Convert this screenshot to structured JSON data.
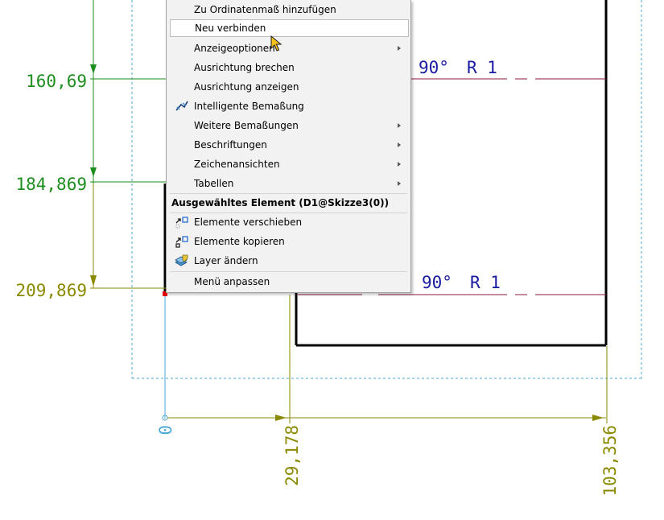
{
  "drawing": {
    "dims_left": [
      {
        "value": "160,69",
        "color": "#1e8f1e"
      },
      {
        "value": "184,869",
        "color": "#1e8f1e"
      },
      {
        "value": "209,869",
        "color": "#8a8a00"
      }
    ],
    "dims_bottom": [
      {
        "value": "0",
        "color": "#4aa7d4"
      },
      {
        "value": "29,178",
        "color": "#8a8a00"
      },
      {
        "value": "103,356",
        "color": "#8a8a00"
      }
    ],
    "annotations": [
      {
        "angle": "90°",
        "radius": "R 1"
      },
      {
        "angle": "90°",
        "radius": "R 1"
      }
    ],
    "colors": {
      "green_dim": "#1e8f1e",
      "olive_dim": "#8a8a00",
      "blue_origin": "#4aa7d4",
      "annotation_text": "#1a1aa0",
      "centerline": "#8b1a3a",
      "sheet_border": "#4aa7d4"
    }
  },
  "menu": {
    "items": [
      {
        "label": "Zu Ordinatenmaß hinzufügen",
        "icon": "",
        "submenu": false
      },
      {
        "label": "Neu verbinden",
        "icon": "",
        "submenu": false,
        "hover": true
      },
      {
        "label": "Anzeigeoptionen",
        "icon": "",
        "submenu": true
      },
      {
        "label": "Ausrichtung brechen",
        "icon": "",
        "submenu": false
      },
      {
        "label": "Ausrichtung anzeigen",
        "icon": "",
        "submenu": false
      },
      {
        "label": "Intelligente Bemaßung",
        "icon": "smart-dimension-icon",
        "submenu": false
      },
      {
        "label": "Weitere Bemaßungen",
        "icon": "",
        "submenu": true
      },
      {
        "label": "Beschriftungen",
        "icon": "",
        "submenu": true
      },
      {
        "label": "Zeichenansichten",
        "icon": "",
        "submenu": true
      },
      {
        "label": "Tabellen",
        "icon": "",
        "submenu": true
      }
    ],
    "section_header": "Ausgewähltes Element (D1@Skizze3(0))",
    "section_items": [
      {
        "label": "Elemente verschieben",
        "icon": "move-entities-icon"
      },
      {
        "label": "Elemente kopieren",
        "icon": "copy-entities-icon"
      },
      {
        "label": "Layer ändern",
        "icon": "change-layer-icon"
      }
    ],
    "footer_item": {
      "label": "Menü anpassen"
    }
  }
}
